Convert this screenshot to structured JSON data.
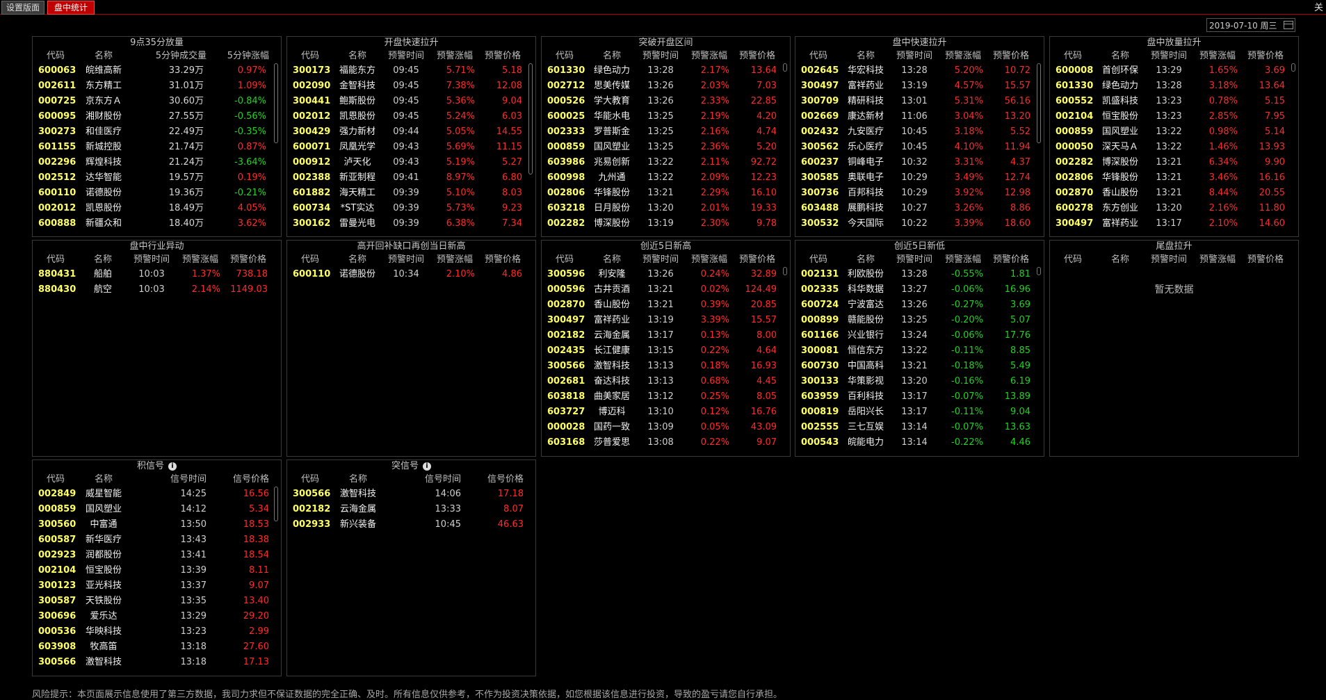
{
  "tabs": {
    "settings": "设置版面",
    "intraday": "盘中统计"
  },
  "close_label": "关",
  "date": "2019-07-10 周三",
  "disclaimer": "风险提示：本页面展示信息使用了第三方数据，我司力求但不保证数据的完全正确、及时。所有信息仅供参考，不作为投资决策依据，如您根据该信息进行投资，导致的盈亏请您自行承担。",
  "panels": [
    {
      "id": "p0",
      "title": "9点35分放量",
      "info": false,
      "headers": [
        "代码",
        "名称",
        "5分钟成交量",
        "5分钟涨幅"
      ],
      "rows": [
        [
          "600063",
          "皖维高新",
          "33.29万",
          "0.97%"
        ],
        [
          "002611",
          "东方精工",
          "31.01万",
          "1.09%"
        ],
        [
          "000725",
          "京东方Ａ",
          "30.60万",
          "-0.84%"
        ],
        [
          "600095",
          "湘财股份",
          "27.55万",
          "-0.56%"
        ],
        [
          "300273",
          "和佳医疗",
          "22.49万",
          "-0.35%"
        ],
        [
          "601155",
          "新城控股",
          "21.74万",
          "0.87%"
        ],
        [
          "002296",
          "辉煌科技",
          "21.24万",
          "-3.64%"
        ],
        [
          "002512",
          "达华智能",
          "19.57万",
          "0.19%"
        ],
        [
          "600110",
          "诺德股份",
          "19.36万",
          "-0.21%"
        ],
        [
          "002012",
          "凯恩股份",
          "18.49万",
          "4.05%"
        ],
        [
          "600888",
          "新疆众和",
          "18.40万",
          "3.62%"
        ]
      ]
    },
    {
      "id": "p1",
      "title": "开盘快速拉升",
      "info": false,
      "headers": [
        "代码",
        "名称",
        "预警时间",
        "预警涨幅",
        "预警价格"
      ],
      "rows": [
        [
          "300173",
          "福能东方",
          "09:45",
          "5.71%",
          "5.18"
        ],
        [
          "002090",
          "金智科技",
          "09:45",
          "7.38%",
          "12.08"
        ],
        [
          "300441",
          "鲍斯股份",
          "09:45",
          "5.36%",
          "9.04"
        ],
        [
          "002012",
          "凯恩股份",
          "09:45",
          "5.24%",
          "6.03"
        ],
        [
          "300429",
          "强力新材",
          "09:44",
          "5.05%",
          "14.55"
        ],
        [
          "600071",
          "凤凰光学",
          "09:43",
          "5.69%",
          "11.15"
        ],
        [
          "000912",
          "泸天化",
          "09:43",
          "5.19%",
          "5.27"
        ],
        [
          "002388",
          "新亚制程",
          "09:41",
          "8.97%",
          "6.80"
        ],
        [
          "601882",
          "海天精工",
          "09:39",
          "5.10%",
          "8.03"
        ],
        [
          "600734",
          "*ST实达",
          "09:39",
          "5.73%",
          "9.23"
        ],
        [
          "300162",
          "雷曼光电",
          "09:39",
          "6.38%",
          "7.34"
        ]
      ]
    },
    {
      "id": "p2",
      "title": "突破开盘区间",
      "info": false,
      "headers": [
        "代码",
        "名称",
        "预警时间",
        "预警涨幅",
        "预警价格"
      ],
      "rows": [
        [
          "601330",
          "绿色动力",
          "13:28",
          "2.17%",
          "13.64"
        ],
        [
          "002712",
          "思美传媒",
          "13:26",
          "2.03%",
          "7.03"
        ],
        [
          "000526",
          "学大教育",
          "13:26",
          "2.33%",
          "22.85"
        ],
        [
          "600025",
          "华能水电",
          "13:25",
          "2.19%",
          "4.20"
        ],
        [
          "002333",
          "罗普斯金",
          "13:25",
          "2.16%",
          "4.74"
        ],
        [
          "000859",
          "国风塑业",
          "13:25",
          "2.36%",
          "5.20"
        ],
        [
          "603986",
          "兆易创新",
          "13:22",
          "2.11%",
          "92.72"
        ],
        [
          "600998",
          "九州通",
          "13:22",
          "2.09%",
          "12.23"
        ],
        [
          "002806",
          "华锋股份",
          "13:21",
          "2.29%",
          "16.10"
        ],
        [
          "603218",
          "日月股份",
          "13:20",
          "2.01%",
          "19.33"
        ],
        [
          "002282",
          "博深股份",
          "13:19",
          "2.30%",
          "9.78"
        ]
      ]
    },
    {
      "id": "p3",
      "title": "盘中快速拉升",
      "info": false,
      "headers": [
        "代码",
        "名称",
        "预警时间",
        "预警涨幅",
        "预警价格"
      ],
      "rows": [
        [
          "002645",
          "华宏科技",
          "13:28",
          "5.20%",
          "10.72"
        ],
        [
          "300497",
          "富祥药业",
          "13:19",
          "4.57%",
          "15.57"
        ],
        [
          "300709",
          "精研科技",
          "13:01",
          "5.31%",
          "56.16"
        ],
        [
          "002669",
          "康达新材",
          "11:06",
          "3.04%",
          "13.20"
        ],
        [
          "002432",
          "九安医疗",
          "10:45",
          "3.18%",
          "5.52"
        ],
        [
          "300562",
          "乐心医疗",
          "10:45",
          "4.10%",
          "11.94"
        ],
        [
          "600237",
          "铜峰电子",
          "10:32",
          "3.31%",
          "4.37"
        ],
        [
          "300585",
          "奥联电子",
          "10:29",
          "3.49%",
          "12.74"
        ],
        [
          "300736",
          "百邦科技",
          "10:29",
          "3.92%",
          "12.98"
        ],
        [
          "603488",
          "展鹏科技",
          "10:27",
          "3.26%",
          "8.86"
        ],
        [
          "300532",
          "今天国际",
          "10:22",
          "3.39%",
          "18.60"
        ]
      ]
    },
    {
      "id": "p4",
      "title": "盘中放量拉升",
      "info": false,
      "headers": [
        "代码",
        "名称",
        "预警时间",
        "预警涨幅",
        "预警价格"
      ],
      "rows": [
        [
          "600008",
          "首创环保",
          "13:29",
          "1.65%",
          "3.69"
        ],
        [
          "601330",
          "绿色动力",
          "13:28",
          "3.18%",
          "13.64"
        ],
        [
          "600552",
          "凯盛科技",
          "13:23",
          "0.78%",
          "5.15"
        ],
        [
          "002104",
          "恒宝股份",
          "13:23",
          "2.85%",
          "7.95"
        ],
        [
          "000859",
          "国风塑业",
          "13:22",
          "0.98%",
          "5.14"
        ],
        [
          "000050",
          "深天马Ａ",
          "13:22",
          "1.46%",
          "13.93"
        ],
        [
          "002282",
          "博深股份",
          "13:21",
          "6.34%",
          "9.90"
        ],
        [
          "002806",
          "华锋股份",
          "13:21",
          "3.46%",
          "16.16"
        ],
        [
          "002870",
          "香山股份",
          "13:21",
          "8.44%",
          "20.55"
        ],
        [
          "600278",
          "东方创业",
          "13:20",
          "2.16%",
          "11.80"
        ],
        [
          "300497",
          "富祥药业",
          "13:17",
          "2.10%",
          "14.60"
        ]
      ]
    },
    {
      "id": "p5",
      "title": "盘中行业异动",
      "info": false,
      "headers": [
        "代码",
        "名称",
        "预警时间",
        "预警涨幅",
        "预警价格"
      ],
      "rows": [
        [
          "880431",
          "船舶",
          "10:03",
          "1.37%",
          "738.18"
        ],
        [
          "880430",
          "航空",
          "10:03",
          "2.14%",
          "1149.03"
        ]
      ]
    },
    {
      "id": "p6",
      "title": "高开回补缺口再创当日新高",
      "info": false,
      "headers": [
        "代码",
        "名称",
        "预警时间",
        "预警涨幅",
        "预警价格"
      ],
      "rows": [
        [
          "600110",
          "诺德股份",
          "10:34",
          "2.10%",
          "4.86"
        ]
      ]
    },
    {
      "id": "p7",
      "title": "创近5日新高",
      "info": false,
      "headers": [
        "代码",
        "名称",
        "预警时间",
        "预警涨幅",
        "预警价格"
      ],
      "rows": [
        [
          "300596",
          "利安隆",
          "13:26",
          "0.24%",
          "32.89"
        ],
        [
          "000596",
          "古井贡酒",
          "13:21",
          "0.02%",
          "124.49"
        ],
        [
          "002870",
          "香山股份",
          "13:21",
          "0.39%",
          "20.85"
        ],
        [
          "300497",
          "富祥药业",
          "13:19",
          "3.39%",
          "15.57"
        ],
        [
          "002182",
          "云海金属",
          "13:17",
          "0.13%",
          "8.00"
        ],
        [
          "002435",
          "长江健康",
          "13:15",
          "0.22%",
          "4.64"
        ],
        [
          "300566",
          "激智科技",
          "13:13",
          "0.18%",
          "16.93"
        ],
        [
          "002681",
          "奋达科技",
          "13:13",
          "0.68%",
          "4.45"
        ],
        [
          "603818",
          "曲美家居",
          "13:12",
          "0.25%",
          "8.05"
        ],
        [
          "603727",
          "博迈科",
          "13:10",
          "0.12%",
          "16.76"
        ],
        [
          "000028",
          "国药一致",
          "13:09",
          "0.05%",
          "43.09"
        ],
        [
          "603168",
          "莎普爱思",
          "13:08",
          "0.22%",
          "9.07"
        ]
      ]
    },
    {
      "id": "p8",
      "title": "创近5日新低",
      "info": false,
      "headers": [
        "代码",
        "名称",
        "预警时间",
        "预警涨幅",
        "预警价格"
      ],
      "rows": [
        [
          "002131",
          "利欧股份",
          "13:28",
          "-0.55%",
          "1.81"
        ],
        [
          "002335",
          "科华数据",
          "13:27",
          "-0.06%",
          "16.96"
        ],
        [
          "600724",
          "宁波富达",
          "13:26",
          "-0.27%",
          "3.69"
        ],
        [
          "000899",
          "赣能股份",
          "13:25",
          "-0.20%",
          "5.07"
        ],
        [
          "601166",
          "兴业银行",
          "13:24",
          "-0.06%",
          "17.76"
        ],
        [
          "300081",
          "恒信东方",
          "13:22",
          "-0.11%",
          "8.85"
        ],
        [
          "600730",
          "中国高科",
          "13:21",
          "-0.18%",
          "5.49"
        ],
        [
          "300133",
          "华策影视",
          "13:20",
          "-0.16%",
          "6.19"
        ],
        [
          "603959",
          "百利科技",
          "13:17",
          "-0.07%",
          "13.89"
        ],
        [
          "000819",
          "岳阳兴长",
          "13:17",
          "-0.11%",
          "9.04"
        ],
        [
          "002555",
          "三七互娱",
          "13:14",
          "-0.07%",
          "13.63"
        ],
        [
          "000543",
          "皖能电力",
          "13:14",
          "-0.22%",
          "4.46"
        ]
      ]
    },
    {
      "id": "p9",
      "title": "尾盘拉升",
      "info": false,
      "headers": [
        "代码",
        "名称",
        "预警时间",
        "预警涨幅",
        "预警价格"
      ],
      "rows": [],
      "empty": "暂无数据"
    },
    {
      "id": "p10",
      "title": "积信号",
      "info": true,
      "headers": [
        "代码",
        "名称",
        "信号时间",
        "信号价格"
      ],
      "rows": [
        [
          "002849",
          "威星智能",
          "14:25",
          "16.56"
        ],
        [
          "000859",
          "国风塑业",
          "14:12",
          "5.34"
        ],
        [
          "300560",
          "中富通",
          "13:50",
          "18.53"
        ],
        [
          "600587",
          "新华医疗",
          "13:43",
          "18.38"
        ],
        [
          "002923",
          "润都股份",
          "13:41",
          "18.54"
        ],
        [
          "002104",
          "恒宝股份",
          "13:39",
          "8.11"
        ],
        [
          "300123",
          "亚光科技",
          "13:37",
          "9.07"
        ],
        [
          "300587",
          "天铁股份",
          "13:35",
          "13.40"
        ],
        [
          "300696",
          "爱乐达",
          "13:29",
          "29.20"
        ],
        [
          "000536",
          "华映科技",
          "13:23",
          "2.99"
        ],
        [
          "603908",
          "牧高笛",
          "13:18",
          "27.60"
        ],
        [
          "300566",
          "激智科技",
          "13:18",
          "17.13"
        ]
      ]
    },
    {
      "id": "p11",
      "title": "突信号",
      "info": true,
      "headers": [
        "代码",
        "名称",
        "信号时间",
        "信号价格"
      ],
      "rows": [
        [
          "300566",
          "激智科技",
          "14:06",
          "17.18"
        ],
        [
          "002182",
          "云海金属",
          "13:33",
          "8.07"
        ],
        [
          "002933",
          "新兴装备",
          "10:45",
          "46.63"
        ]
      ]
    }
  ]
}
